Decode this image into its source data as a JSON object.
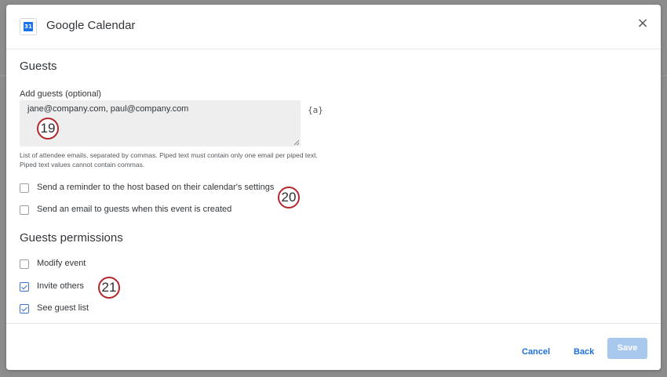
{
  "dialog": {
    "title": "Google Calendar",
    "close_icon": "×"
  },
  "guests": {
    "section_title": "Guests",
    "add_label": "Add guests (optional)",
    "textarea_value": "jane@company.com, paul@company.com",
    "piped_text_icon": "{a}",
    "help_text": "List of attendee emails, separated by commas. Piped text must contain only one email per piped text. Piped text values cannot contain commas.",
    "options": [
      {
        "label": "Send a reminder to the host based on their calendar's settings",
        "checked": false
      },
      {
        "label": "Send an email to guests when this event is created",
        "checked": false
      }
    ]
  },
  "permissions": {
    "section_title": "Guests permissions",
    "options": [
      {
        "label": "Modify event",
        "checked": false
      },
      {
        "label": "Invite others",
        "checked": true
      },
      {
        "label": "See guest list",
        "checked": true
      }
    ]
  },
  "callouts": [
    "19",
    "20",
    "21"
  ],
  "footer": {
    "cancel_label": "Cancel",
    "back_label": "Back",
    "save_label": "Save"
  },
  "colors": {
    "accent": "#1e6fd9",
    "save_disabled": "#a8c8ee",
    "callout_ring": "#b3282d"
  }
}
